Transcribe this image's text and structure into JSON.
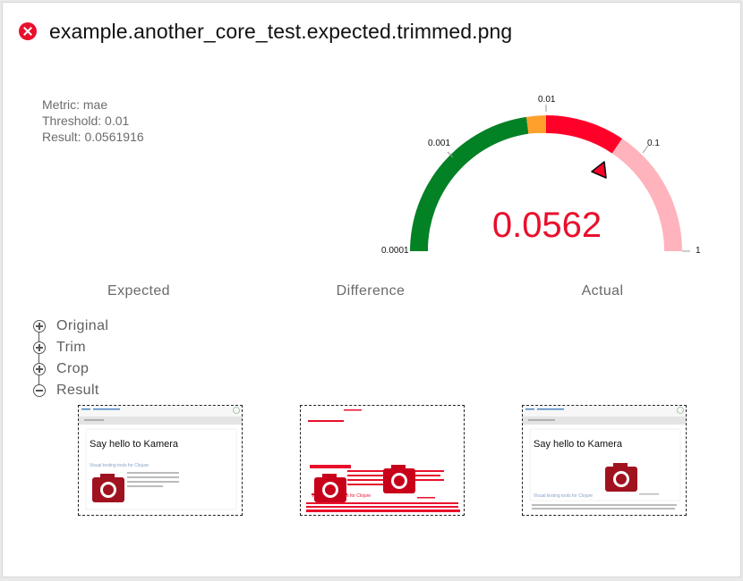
{
  "header": {
    "title": "example.another_core_test.expected.trimmed.png",
    "status_icon": "error-icon"
  },
  "metrics": {
    "metric": "Metric: mae",
    "threshold": "Threshold: 0.01",
    "result": "Result: 0.0561916"
  },
  "gauge": {
    "value_label": "0.0562",
    "value": 0.0562,
    "scale": "log",
    "range": [
      0.0001,
      1
    ],
    "tick_labels": [
      "0.0001",
      "0.001",
      "0.01",
      "0.1",
      "1"
    ],
    "colors": {
      "pass": "#038125",
      "warn": "#ff9f2c",
      "fail": "#ff0029",
      "far": "#ffb3bc"
    }
  },
  "columns": {
    "expected": "Expected",
    "difference": "Difference",
    "actual": "Actual"
  },
  "steps": [
    {
      "label": "Original",
      "state": "collapsed"
    },
    {
      "label": "Trim",
      "state": "collapsed"
    },
    {
      "label": "Crop",
      "state": "collapsed"
    },
    {
      "label": "Result",
      "state": "expanded"
    }
  ],
  "thumbs": {
    "expected": {
      "heading": "Say hello to Kamera",
      "subheading": "Visual testing tools for Clojure"
    },
    "actual": {
      "heading": "Say hello to Kamera",
      "subheading": "Visual testing tools for Clojure"
    },
    "difference": {
      "subheading": "Visual testing tools for Clojure"
    }
  }
}
